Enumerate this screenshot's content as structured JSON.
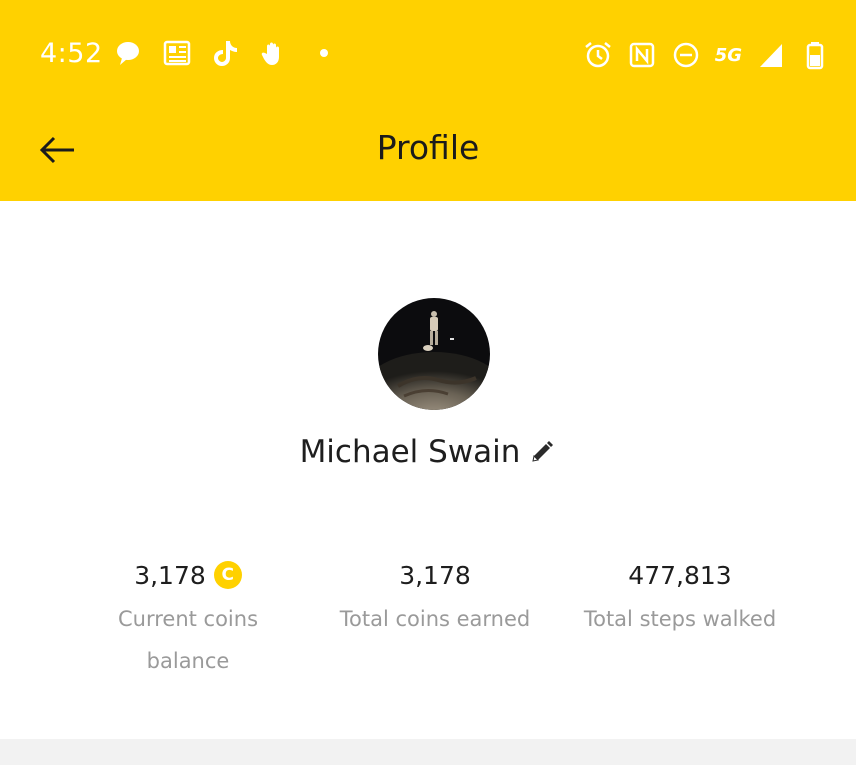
{
  "status_bar": {
    "time": "4:52",
    "network": "5G",
    "left_icons": [
      "chat-bubble-icon",
      "news-icon",
      "tiktok-icon",
      "hand-icon",
      "notification-dot-icon"
    ],
    "right_icons": [
      "alarm-icon",
      "nfc-icon",
      "do-not-disturb-icon",
      "5g-icon",
      "signal-icon",
      "battery-icon"
    ]
  },
  "app_bar": {
    "title": "Profile",
    "back_icon": "arrow-left-icon",
    "color": "#FFD100"
  },
  "profile": {
    "name": "Michael Swain",
    "edit_icon": "pencil-icon",
    "avatar": "profile-photo"
  },
  "stats": [
    {
      "value": "3,178",
      "label": "Current coins balance",
      "icon": "coin-icon",
      "icon_letter": "C"
    },
    {
      "value": "3,178",
      "label": "Total coins earned"
    },
    {
      "value": "477,813",
      "label": "Total steps walked"
    }
  ]
}
